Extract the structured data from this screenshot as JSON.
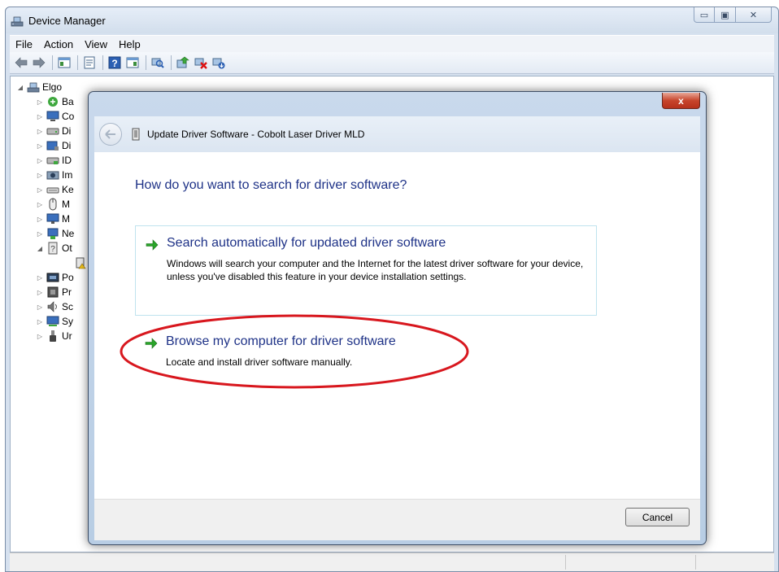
{
  "window": {
    "title": "Device Manager",
    "caption_buttons": {
      "minimize": "▭",
      "maximize": "▣",
      "close": "✕"
    }
  },
  "menu": [
    "File",
    "Action",
    "View",
    "Help"
  ],
  "toolbar_icons": [
    "back-icon",
    "forward-icon",
    "console-tree-icon",
    "properties-icon",
    "help-icon",
    "action-pane-icon",
    "scan-hardware-icon",
    "update-driver-icon",
    "disable-device-icon",
    "uninstall-device-icon"
  ],
  "tree": {
    "root": "Elgo",
    "items": [
      {
        "label": "Ba",
        "icon": "battery-icon"
      },
      {
        "label": "Co",
        "icon": "computer-icon"
      },
      {
        "label": "Di",
        "icon": "disk-drive-icon"
      },
      {
        "label": "Di",
        "icon": "display-adapter-icon"
      },
      {
        "label": "ID",
        "icon": "ide-controller-icon"
      },
      {
        "label": "Im",
        "icon": "imaging-device-icon"
      },
      {
        "label": "Ke",
        "icon": "keyboard-icon"
      },
      {
        "label": "M",
        "icon": "mouse-icon"
      },
      {
        "label": "M",
        "icon": "monitor-icon"
      },
      {
        "label": "Ne",
        "icon": "network-adapter-icon"
      },
      {
        "label": "Ot",
        "icon": "other-devices-icon"
      },
      {
        "label": "",
        "icon": "unknown-device-icon"
      },
      {
        "label": "Po",
        "icon": "ports-icon"
      },
      {
        "label": "Pr",
        "icon": "processor-icon"
      },
      {
        "label": "Sc",
        "icon": "sound-icon"
      },
      {
        "label": "Sy",
        "icon": "system-devices-icon"
      },
      {
        "label": "Ur",
        "icon": "usb-controller-icon"
      }
    ]
  },
  "dialog": {
    "close_label": "x",
    "title": "Update Driver Software - Cobolt Laser Driver MLD",
    "question": "How do you want to search for driver software?",
    "options": [
      {
        "title": "Search automatically for updated driver software",
        "description": "Windows will search your computer and the Internet for the latest driver software for your device, unless you've disabled this feature in your device installation settings."
      },
      {
        "title": "Browse my computer for driver software",
        "description": "Locate and install driver software manually."
      }
    ],
    "cancel_label": "Cancel"
  },
  "colors": {
    "heading_blue": "#1e3287",
    "arrow_green": "#2aa52a",
    "highlight_red": "#d8171e",
    "close_red": "#c7452c"
  }
}
